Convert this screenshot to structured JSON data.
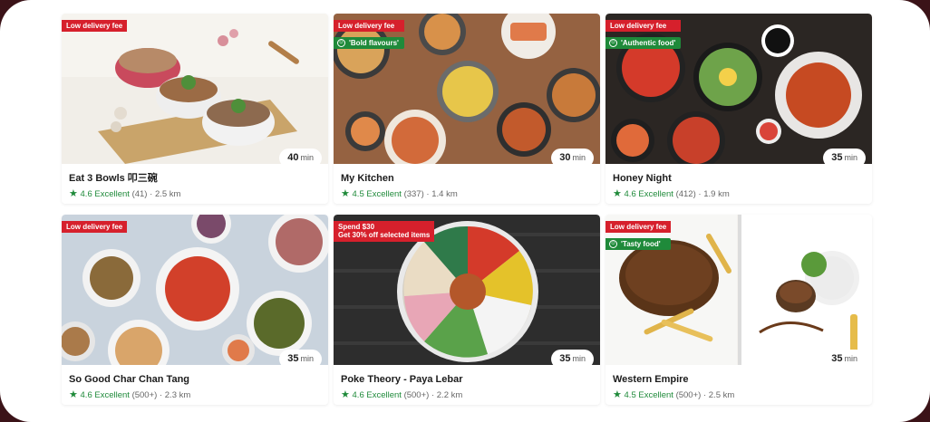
{
  "accent_red": "#d6202c",
  "accent_green": "#1f8a3a",
  "star_icon": "star-icon",
  "restaurants": [
    {
      "name": "Eat 3 Bowls 叩三碗",
      "badges": [
        "Low delivery fee"
      ],
      "tag": "",
      "time": "40",
      "time_unit": "min",
      "rating": "4.6",
      "rating_label": "Excellent",
      "reviews": "(41)",
      "distance": "2.5 km"
    },
    {
      "name": "My Kitchen",
      "badges": [
        "Low delivery fee"
      ],
      "tag": "'Bold flavours'",
      "time": "30",
      "time_unit": "min",
      "rating": "4.5",
      "rating_label": "Excellent",
      "reviews": "(337)",
      "distance": "1.4 km"
    },
    {
      "name": "Honey Night",
      "badges": [
        "Low delivery fee"
      ],
      "tag": "'Authentic food'",
      "time": "35",
      "time_unit": "min",
      "rating": "4.6",
      "rating_label": "Excellent",
      "reviews": "(412)",
      "distance": "1.9 km"
    },
    {
      "name": "So Good Char Chan Tang",
      "badges": [
        "Low delivery fee"
      ],
      "tag": "",
      "time": "35",
      "time_unit": "min",
      "rating": "4.6",
      "rating_label": "Excellent",
      "reviews": "(500+)",
      "distance": "2.3 km"
    },
    {
      "name": "Poke Theory - Paya Lebar",
      "badges": [
        "Spend $30",
        "Get 30% off selected items"
      ],
      "tag": "",
      "time": "35",
      "time_unit": "min",
      "rating": "4.6",
      "rating_label": "Excellent",
      "reviews": "(500+)",
      "distance": "2.2 km"
    },
    {
      "name": "Western Empire",
      "badges": [
        "Low delivery fee"
      ],
      "tag": "'Tasty food'",
      "time": "35",
      "time_unit": "min",
      "rating": "4.5",
      "rating_label": "Excellent",
      "reviews": "(500+)",
      "distance": "2.5 km"
    }
  ]
}
